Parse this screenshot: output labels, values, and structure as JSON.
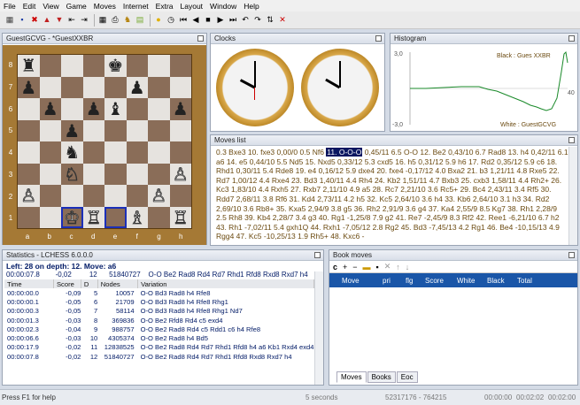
{
  "menu": [
    "File",
    "Edit",
    "View",
    "Game",
    "Moves",
    "Internet",
    "Extra",
    "Layout",
    "Window",
    "Help"
  ],
  "board": {
    "title": "GuestGCVG - *GuestXXBR",
    "ranks": [
      "8",
      "7",
      "6",
      "5",
      "4",
      "3",
      "2",
      "1"
    ],
    "files": [
      "a",
      "b",
      "c",
      "d",
      "e",
      "f",
      "g",
      "h"
    ],
    "pieces": [
      [
        "♜",
        "",
        "",
        "",
        "♚",
        "",
        "",
        ""
      ],
      [
        "♟",
        "",
        "",
        "",
        "",
        "♟",
        "",
        ""
      ],
      [
        "",
        "♟",
        "",
        "♟",
        "♝",
        "",
        "",
        "♟"
      ],
      [
        "",
        "",
        "♟",
        "",
        "",
        "",
        "",
        ""
      ],
      [
        "",
        "",
        "♞",
        "",
        "",
        "",
        "",
        ""
      ],
      [
        "",
        "",
        "♘",
        "",
        "",
        "",
        "",
        "♙"
      ],
      [
        "♙",
        "",
        "",
        "",
        "",
        "",
        "♙",
        ""
      ],
      [
        "",
        "",
        "♔",
        "♖",
        "",
        "♗",
        "",
        "♖"
      ]
    ]
  },
  "clocks": {
    "title": "Clocks"
  },
  "histogram": {
    "title": "Histogram",
    "top_label": "3,0",
    "bottom_label": "-3,0",
    "x_end": "40",
    "black_label": "Black : Gues XXBR",
    "white_label": "White : GuestGCVG"
  },
  "moves": {
    "title": "Moves list",
    "before": "0.3 Bxe3 10. fxe3 0,00/0 0.5 Nf6",
    "current": "11. O-O-O",
    "after": "0,45/11 6.5 O-O 12. Be2 0,43/10 6.7 Rad8 13. h4 0,42/11 6.1 a6 14. e5 0,44/10 5.5 Nd5 15. Nxd5 0,33/12 5.3 cxd5 16. h5 0,31/12 5.9 h6 17. Rd2 0,35/12 5.9 c6 18. Rhd1 0,30/11 5.4 Rde8 19. e4 0,16/12 5.9 dxe4 20. fxe4 -0,17/12 4.0 Bxa2 21. b3 1,21/11 4.8 Rxe5 22. Rd7 1,00/12 4.4 Rxe4 23. Bd3 1,40/11 4.4 Rh4 24. Kb2 1,51/11 4.7 Bxb3 25. cxb3 1,58/11 4.4 Rh2+ 26. Kc3 1,83/10 4.4 Rxh5 27. Rxb7 2,11/10 4.9 a5 28. Rc7 2,21/10 3.6 Rc5+ 29. Bc4 2,43/11 3.4 Rf5 30. Rdd7 2,68/11 3.8 Rf6 31. Kd4 2,73/11 4.2 h5 32. Kc5 2,64/10 3.6 h4 33. Kb6 2,64/10 3.1 h3 34. Rd2 2,69/10 3.6 Rb8+ 35. Kxa5 2,94/9 3.8 g5 36. Rh2 2,91/9 3.6 g4 37. Ka4 2,55/9 8.5 Kg7 38. Rh1 2,28/9 2.5 Rh8 39. Kb4 2,28/7 3.4 g3 40. Rg1 -1,25/8 7.9 g2 41. Re7 -2,45/9 8.3 Rf2 42. Ree1 -6,21/10 6.7 h2 43. Rh1 -7,02/11 5.4 gxh1Q 44. Rxh1 -7,05/12 2.8 Rg2 45. Bd3 -7,45/13 4.2 Rg1 46. Be4 -10,15/13 4.9 Rgg4 47. Kc5 -10,25/13 1.9 Rh5+ 48. Kxc6 -"
  },
  "stats": {
    "title": "Statistics - LCHESS 6.0.0.0",
    "line1": "Left:  28  on depth: 12.  Move: a6",
    "line2": "00:00:07.8        -0,02         12      51840727    O-O Be2 Rad8 Rd4 Rd7 Rhd1 Rfd8 Rxd8 Rxd7 h4",
    "headers": [
      "Time",
      "Score",
      "D",
      "Nodes",
      "Variation"
    ],
    "rows": [
      [
        "00:00:00.0",
        "-0,09",
        "5",
        "10057",
        "O-O Bd3 Rad8 h4 Rfe8"
      ],
      [
        "00:00:00.1",
        "-0,05",
        "6",
        "21709",
        "O-O Bd3 Rad8 h4 Rfe8 Rhg1"
      ],
      [
        "00:00:00.3",
        "-0,05",
        "7",
        "58114",
        "O-O Bd3 Rad8 h4 Rfe8 Rhg1 Nd7"
      ],
      [
        "00:00:01.3",
        "-0,03",
        "8",
        "369836",
        "O-O Be2 Rfd8 Rd4 c5 exd4"
      ],
      [
        "00:00:02.3",
        "-0,04",
        "9",
        "988757",
        "O-O Be2 Rad8 Rd4 c5 Rdd1 c6 h4 Rfe8"
      ],
      [
        "00:00:06.6",
        "-0,03",
        "10",
        "4305374",
        "O-O Be2 Rad8 h4 Bd5"
      ],
      [
        "00:00:17.9",
        "-0,02",
        "11",
        "12838525",
        "O-O Be2 Rad8 Rd4 Rd7 Rhd1 Rfd8 h4 a6 Kb1 Rxd4 exd4"
      ],
      [
        "00:00:07.8",
        "-0,02",
        "12",
        "51840727",
        "O-O Be2 Rad8 Rd4 Rd7 Rhd1 Rfd8 Rxd8 Rxd7 h4"
      ]
    ]
  },
  "book": {
    "title": "Book moves",
    "headers": [
      "Move",
      "pri",
      "flg",
      "Score",
      "White",
      "Black",
      "Total"
    ],
    "tabs": [
      "Moves",
      "Books",
      "Eoc"
    ]
  },
  "status": {
    "help": "Press F1 for help",
    "seconds": "5 seconds",
    "nodes": "52317176 - 764215",
    "t1": "00:00:00",
    "t2": "00:02:02",
    "t3": "00:02:00"
  },
  "colors": {
    "accent": "#1a56a8",
    "board_dark": "#8a6d58",
    "board_light": "#e6e3df",
    "frame": "#a57935",
    "moves_text": "#6b4a10",
    "stats_text": "#001a66"
  }
}
